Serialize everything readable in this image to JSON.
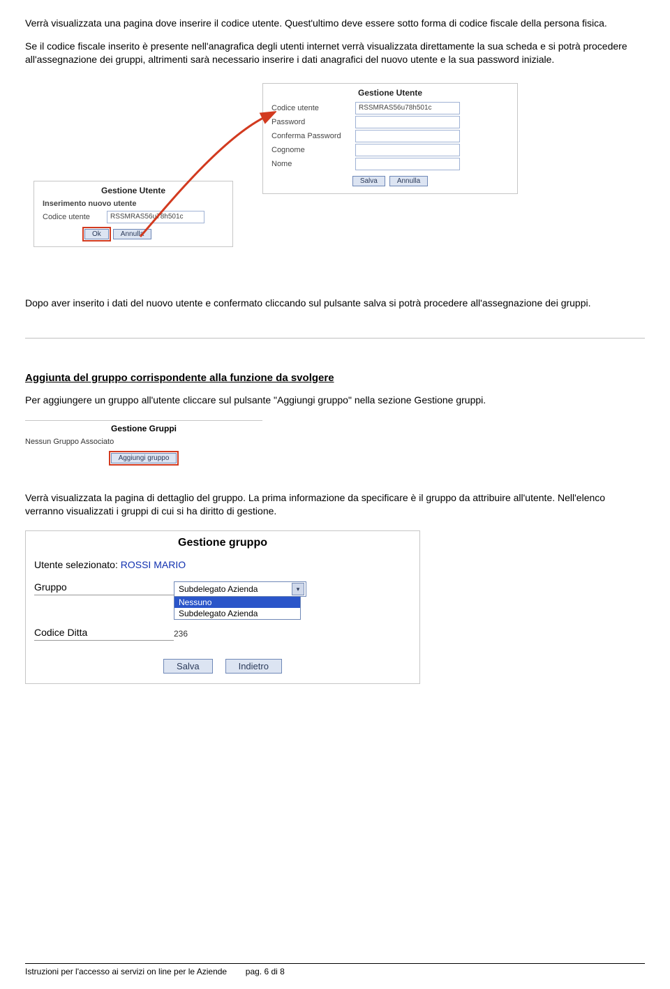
{
  "para1": "Verrà visualizzata una pagina dove inserire il codice utente. Quest'ultimo deve essere sotto forma di codice fiscale della persona fisica.",
  "para2": "Se il codice fiscale inserito è presente nell'anagrafica degli utenti internet verrà visualizzata direttamente la sua scheda e si potrà procedere all'assegnazione dei gruppi, altrimenti sarà necessario inserire i dati anagrafici del nuovo utente e la sua password iniziale.",
  "fig1": {
    "big": {
      "title": "Gestione Utente",
      "labels": {
        "codice": "Codice utente",
        "password": "Password",
        "conferma": "Conferma Password",
        "cognome": "Cognome",
        "nome": "Nome"
      },
      "value_codice": "RSSMRAS56u78h501c",
      "btn_salva": "Salva",
      "btn_annulla": "Annulla"
    },
    "small": {
      "title": "Gestione Utente",
      "subtitle": "Inserimento nuovo utente",
      "label_codice": "Codice utente",
      "value_codice": "RSSMRAS56u78h501c",
      "btn_ok": "Ok",
      "btn_annulla": "Annulla"
    }
  },
  "para3": "Dopo aver inserito i dati del nuovo utente e confermato cliccando sul pulsante salva si potrà procedere all'assegnazione dei gruppi.",
  "heading1": "Aggiunta del gruppo corrispondente alla funzione da svolgere",
  "para4": "Per aggiungere un gruppo all'utente cliccare sul pulsante \"Aggiungi gruppo\" nella sezione Gestione gruppi.",
  "fig2": {
    "title": "Gestione Gruppi",
    "note": "Nessun Gruppo Associato",
    "btn": "Aggiungi gruppo"
  },
  "para5": "Verrà visualizzata la pagina di dettaglio del gruppo. La prima informazione da specificare è il gruppo da attribuire all'utente. Nell'elenco verranno visualizzati i gruppi di cui si ha diritto di gestione.",
  "fig3": {
    "title": "Gestione gruppo",
    "user_label": "Utente selezionato:",
    "user_name": "ROSSI MARIO",
    "lbl_gruppo": "Gruppo",
    "select_value": "Subdelegato Azienda",
    "opt1": "Nessuno",
    "opt2": "Subdelegato Azienda",
    "lbl_codice_ditta": "Codice Ditta",
    "codice_ditta_val": "236",
    "btn_salva": "Salva",
    "btn_indietro": "Indietro"
  },
  "footer": {
    "text_left": "Istruzioni per l'accesso ai servizi on line per le Aziende",
    "text_right": "pag. 6 di 8"
  }
}
